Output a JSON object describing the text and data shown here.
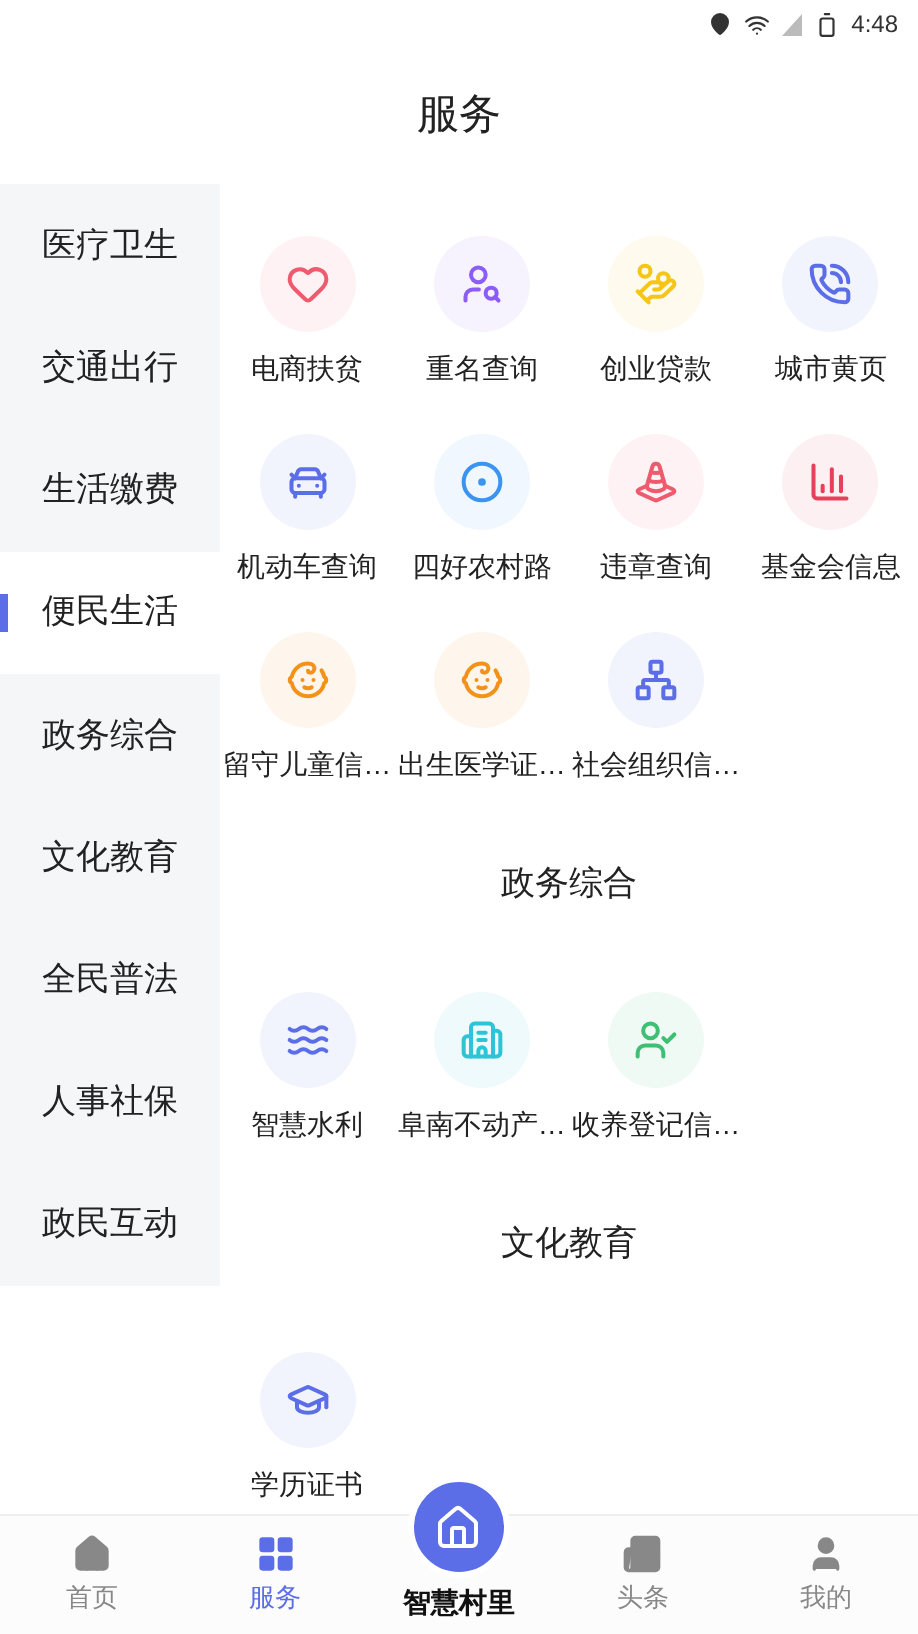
{
  "status_bar": {
    "time": "4:48"
  },
  "title": "服务",
  "sidebar": {
    "items": [
      {
        "label": "医疗卫生",
        "selected": false
      },
      {
        "label": "交通出行",
        "selected": false
      },
      {
        "label": "生活缴费",
        "selected": false
      },
      {
        "label": "便民生活",
        "selected": true
      },
      {
        "label": "政务综合",
        "selected": false
      },
      {
        "label": "文化教育",
        "selected": false
      },
      {
        "label": "全民普法",
        "selected": false
      },
      {
        "label": "人事社保",
        "selected": false
      },
      {
        "label": "政民互动",
        "selected": false
      }
    ]
  },
  "sections": [
    {
      "items": [
        {
          "label": "电商扶贫",
          "color": "#ef5b6e"
        },
        {
          "label": "重名查询",
          "color": "#8b5cf6"
        },
        {
          "label": "创业贷款",
          "color": "#f5c518"
        },
        {
          "label": "城市黄页",
          "color": "#5b6ee8"
        },
        {
          "label": "机动车查询",
          "color": "#5b6ee8"
        },
        {
          "label": "四好农村路",
          "color": "#3b95f0"
        },
        {
          "label": "违章查询",
          "color": "#ef5b6e"
        },
        {
          "label": "基金会信息",
          "color": "#e8405a"
        },
        {
          "label": "留守儿童信…",
          "color": "#f39218"
        },
        {
          "label": "出生医学证…",
          "color": "#f39218"
        },
        {
          "label": "社会组织信…",
          "color": "#5b6ee8"
        }
      ]
    },
    {
      "heading": "政务综合",
      "items": [
        {
          "label": "智慧水利",
          "color": "#5b6ee8"
        },
        {
          "label": "阜南不动产…",
          "color": "#2ec4d6"
        },
        {
          "label": "收养登记信…",
          "color": "#3fbf73"
        }
      ]
    },
    {
      "heading": "文化教育",
      "items": [
        {
          "label": "学历证书",
          "color": "#5b6ee8"
        }
      ]
    }
  ],
  "bottom_nav": [
    {
      "label": "首页",
      "selected": false
    },
    {
      "label": "服务",
      "selected": true
    },
    {
      "label": "智慧村里",
      "selected": false
    },
    {
      "label": "头条",
      "selected": false
    },
    {
      "label": "我的",
      "selected": false
    }
  ]
}
